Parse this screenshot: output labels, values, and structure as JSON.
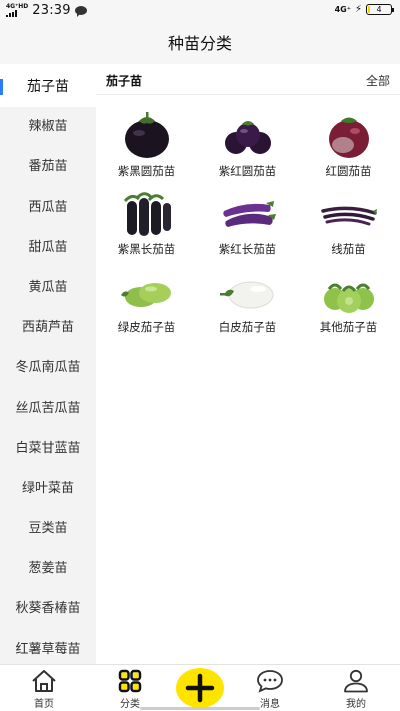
{
  "status_bar": {
    "network_left": "4G⁺HD",
    "time": "23:39",
    "network_right": "4G⁺",
    "battery": "4",
    "battery_level_percent": 4
  },
  "header": {
    "title": "种苗分类"
  },
  "sidebar": {
    "items": [
      {
        "label": "茄子苗",
        "active": true
      },
      {
        "label": "辣椒苗"
      },
      {
        "label": "番茄苗"
      },
      {
        "label": "西瓜苗"
      },
      {
        "label": "甜瓜苗"
      },
      {
        "label": "黄瓜苗"
      },
      {
        "label": "西葫芦苗"
      },
      {
        "label": "冬瓜南瓜苗"
      },
      {
        "label": "丝瓜苦瓜苗"
      },
      {
        "label": "白菜甘蓝苗"
      },
      {
        "label": "绿叶菜苗"
      },
      {
        "label": "豆类苗"
      },
      {
        "label": "葱姜苗"
      },
      {
        "label": "秋葵香椿苗"
      },
      {
        "label": "红薯草莓苗"
      }
    ]
  },
  "main": {
    "section_title": "茄子苗",
    "all_label": "全部",
    "items": [
      {
        "label": "紫黑圆茄苗",
        "icon": "round-black-eggplant-icon"
      },
      {
        "label": "紫红圆茄苗",
        "icon": "round-purple-eggplant-icon"
      },
      {
        "label": "红圆茄苗",
        "icon": "round-red-eggplant-icon"
      },
      {
        "label": "紫黑长茄苗",
        "icon": "long-black-eggplant-icon"
      },
      {
        "label": "紫红长茄苗",
        "icon": "long-purple-eggplant-icon"
      },
      {
        "label": "线茄苗",
        "icon": "thin-eggplant-icon"
      },
      {
        "label": "绿皮茄子苗",
        "icon": "green-eggplant-icon"
      },
      {
        "label": "白皮茄子苗",
        "icon": "white-eggplant-icon"
      },
      {
        "label": "其他茄子苗",
        "icon": "other-eggplant-icon"
      }
    ]
  },
  "tab_bar": {
    "tabs": [
      {
        "label": "首页",
        "icon": "home-icon"
      },
      {
        "label": "分类",
        "icon": "category-grid-icon",
        "active": true
      },
      {
        "label": "",
        "icon": "plus-icon"
      },
      {
        "label": "消息",
        "icon": "message-icon"
      },
      {
        "label": "我的",
        "icon": "profile-icon"
      }
    ]
  },
  "colors": {
    "accent_blue": "#2f7cf6",
    "fab_yellow": "#ffe400",
    "battery_yellow": "#f1d300",
    "sidebar_bg": "#f3f3f3"
  }
}
